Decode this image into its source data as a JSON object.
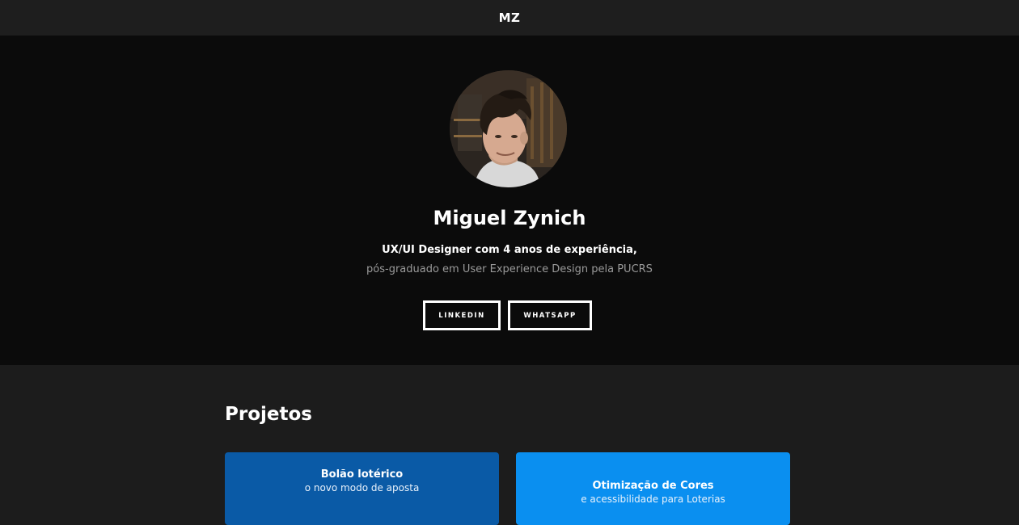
{
  "header": {
    "logo": "MZ"
  },
  "hero": {
    "name": "Miguel Zynich",
    "headline": "UX/UI Designer com 4 anos de experiência,",
    "subheadline": "pós-graduado em User Experience Design pela PUCRS",
    "buttons": [
      {
        "label": "LINKEDIN"
      },
      {
        "label": "WHATSAPP"
      }
    ]
  },
  "projects": {
    "title": "Projetos",
    "cards": [
      {
        "title": "Bolão lotérico",
        "subtitle": "o novo modo de aposta",
        "color": "#0a5aa6"
      },
      {
        "title": "Otimização de Cores",
        "subtitle": "e acessibilidade para Loterias",
        "color": "#0a8ff0"
      }
    ]
  },
  "colors": {
    "topbar": "#1e1e1e",
    "hero_bg": "#0b0b0b",
    "page_bg": "#1c1c1c",
    "text": "#ffffff",
    "muted_text": "#9a9a9a"
  }
}
